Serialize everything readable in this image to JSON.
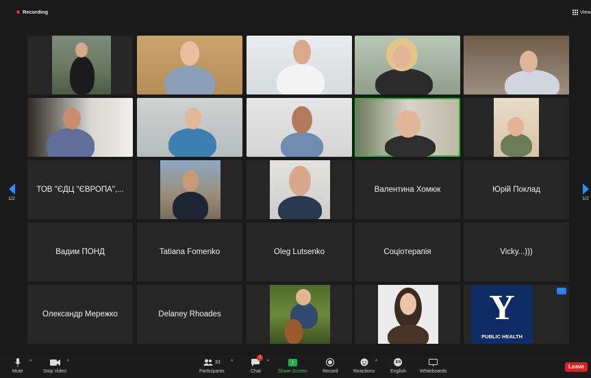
{
  "topbar": {
    "recording_label": "Recording",
    "view_label": "View"
  },
  "pagination": {
    "left": "1/2",
    "right": "1/2"
  },
  "tiles": {
    "r3c1": "ТОВ \"ЄДЦ \"ЄВРОПА\",...",
    "r3c4": "Валентина Хомюк",
    "r3c5": "Юрій Поклад",
    "r4c1": "Вадим ПОНД",
    "r4c2": "Tatiana Fomenko",
    "r4c3": "Oleg Lutsenko",
    "r4c4": "Соціотерапія",
    "r4c5": "Vicky...)))",
    "r5c1": "Олександр Мережко",
    "r5c2": "Delaney Rhoades"
  },
  "yale": {
    "letter": "Y",
    "caption": "PUBLIC HEALTH"
  },
  "tile_menu_icon": "ellipsis-icon",
  "toolbar": {
    "mute": "Mute",
    "stop_video": "Stop Video",
    "participants": "Participants",
    "participants_count": "33",
    "chat": "Chat",
    "chat_badge": "1",
    "share_screen": "Share Screen",
    "record": "Record",
    "reactions": "Reactions",
    "english": "English",
    "english_icon": "EN",
    "whiteboards": "Whiteboards",
    "leave": "Leave"
  },
  "colors": {
    "accent": "#2d8cff",
    "leave": "#d62424",
    "active_speaker": "#27b43c",
    "share": "#23b14d"
  }
}
